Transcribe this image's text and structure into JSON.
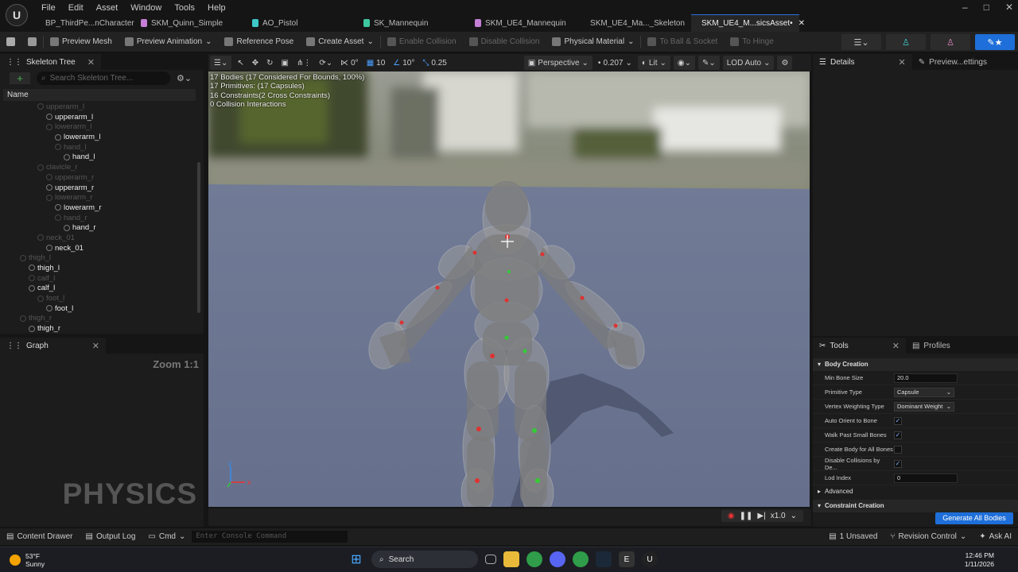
{
  "app": {
    "logo_text": "U"
  },
  "menu": [
    "File",
    "Edit",
    "Asset",
    "Window",
    "Tools",
    "Help"
  ],
  "tabs": [
    {
      "label": "BP_ThirdPe...nCharacter",
      "color": "#3b6fd6"
    },
    {
      "label": "SKM_Quinn_Simple",
      "color": "#c57fd6"
    },
    {
      "label": "AO_Pistol",
      "color": "#3ec8c8"
    },
    {
      "label": "SK_Mannequin",
      "color": "#3ec8a0"
    },
    {
      "label": "SKM_UE4_Mannequin",
      "color": "#c57fd6"
    },
    {
      "label": "SKM_UE4_Ma..._Skeleton",
      "color": "#3ec8a0"
    },
    {
      "label": "SKM_UE4_M...sicsAsset•",
      "color": "#e0b030",
      "active": true
    }
  ],
  "window_controls": [
    "–",
    "□",
    "✕"
  ],
  "toolbar": {
    "preview_mesh": "Preview Mesh",
    "preview_animation": "Preview Animation",
    "reference_pose": "Reference Pose",
    "create_asset": "Create Asset",
    "enable_collision": "Enable Collision",
    "disable_collision": "Disable Collision",
    "physical_material": "Physical Material",
    "to_ball_socket": "To Ball & Socket",
    "to_hinge": "To Hinge"
  },
  "skeleton_tree": {
    "title": "Skeleton Tree",
    "search_placeholder": "Search Skeleton Tree...",
    "column": "Name",
    "rows": [
      {
        "label": "upperarm_l",
        "indent": 3,
        "kind": "dim"
      },
      {
        "label": "upperarm_l",
        "indent": 4,
        "kind": "lit"
      },
      {
        "label": "lowerarm_l",
        "indent": 4,
        "kind": "dim"
      },
      {
        "label": "lowerarm_l",
        "indent": 5,
        "kind": "lit"
      },
      {
        "label": "hand_l",
        "indent": 5,
        "kind": "dim"
      },
      {
        "label": "hand_l",
        "indent": 6,
        "kind": "lit"
      },
      {
        "label": "clavicle_r",
        "indent": 3,
        "kind": "dim"
      },
      {
        "label": "upperarm_r",
        "indent": 4,
        "kind": "dim"
      },
      {
        "label": "upperarm_r",
        "indent": 4,
        "kind": "lit"
      },
      {
        "label": "lowerarm_r",
        "indent": 4,
        "kind": "dim"
      },
      {
        "label": "lowerarm_r",
        "indent": 5,
        "kind": "lit"
      },
      {
        "label": "hand_r",
        "indent": 5,
        "kind": "dim"
      },
      {
        "label": "hand_r",
        "indent": 6,
        "kind": "lit"
      },
      {
        "label": "neck_01",
        "indent": 3,
        "kind": "dim"
      },
      {
        "label": "neck_01",
        "indent": 4,
        "kind": "lit"
      },
      {
        "label": "thigh_l",
        "indent": 1,
        "kind": "dim"
      },
      {
        "label": "thigh_l",
        "indent": 2,
        "kind": "lit"
      },
      {
        "label": "calf_l",
        "indent": 2,
        "kind": "dim"
      },
      {
        "label": "calf_l",
        "indent": 2,
        "kind": "lit"
      },
      {
        "label": "foot_l",
        "indent": 3,
        "kind": "dim"
      },
      {
        "label": "foot_l",
        "indent": 4,
        "kind": "lit"
      },
      {
        "label": "thigh_r",
        "indent": 1,
        "kind": "dim"
      },
      {
        "label": "thigh_r",
        "indent": 2,
        "kind": "lit"
      }
    ]
  },
  "graph": {
    "title": "Graph",
    "zoom": "Zoom 1:1",
    "watermark": "PHYSICS"
  },
  "viewport_bar": {
    "snap1": "0°",
    "snap2": "10",
    "snap3": "10°",
    "snap4": "0.25",
    "perspective": "Perspective",
    "value": "0.207",
    "lit": "Lit",
    "lod": "LOD Auto"
  },
  "viewport": {
    "stats": [
      "17 Bodies (17 Considered For Bounds, 100%)",
      "17 Primitives: (17 Capsules)",
      "16 Constraints(2 Cross Constraints)",
      "0 Collision Interactions"
    ],
    "axis_z": "z",
    "axis_x": "x"
  },
  "playback": {
    "speed": "x1.0"
  },
  "details": {
    "tab1": "Details",
    "tab2": "Preview...ettings"
  },
  "tools": {
    "tab1": "Tools",
    "tab2": "Profiles",
    "section_body": "Body Creation",
    "props": [
      {
        "label": "Min Bone Size",
        "type": "field",
        "value": "20.0"
      },
      {
        "label": "Primitive Type",
        "type": "combo",
        "value": "Capsule"
      },
      {
        "label": "Vertex Weighting Type",
        "type": "combo",
        "value": "Dominant Weight"
      },
      {
        "label": "Auto Orient to Bone",
        "type": "check",
        "value": "✓"
      },
      {
        "label": "Walk Past Small Bones",
        "type": "check",
        "value": "✓"
      },
      {
        "label": "Create Body for All Bones",
        "type": "check",
        "value": ""
      },
      {
        "label": "Disable Collisions by De...",
        "type": "check",
        "value": "✓"
      },
      {
        "label": "Lod Index",
        "type": "field",
        "value": "0"
      }
    ],
    "section_advanced": "Advanced",
    "section_constraint": "Constraint Creation",
    "generate": "Generate All Bodies"
  },
  "statusbar": {
    "content_drawer": "Content Drawer",
    "output_log": "Output Log",
    "cmd": "Cmd",
    "console_placeholder": "Enter Console Command",
    "unsaved": "1 Unsaved",
    "revision": "Revision Control",
    "ask_ai": "Ask AI"
  },
  "taskbar": {
    "temp": "53°F",
    "condition": "Sunny",
    "search": "Search",
    "time": "12:46 PM",
    "date": "1/11/2026"
  }
}
